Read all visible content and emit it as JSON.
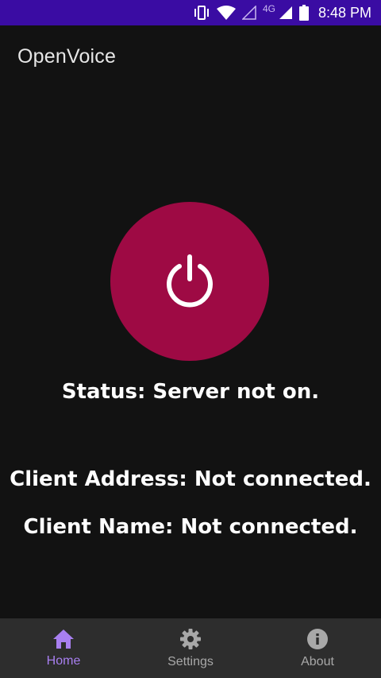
{
  "status_bar": {
    "network_type": "4G",
    "time": "8:48 PM",
    "icons": [
      "vibrate-icon",
      "wifi-icon",
      "signal-empty-icon",
      "signal-icon",
      "battery-icon"
    ]
  },
  "app_bar": {
    "title": "OpenVoice"
  },
  "main": {
    "power_button_icon": "power-icon",
    "power_button_color": "#9e0a44",
    "status_text": "Status: Server not on.",
    "client_address_text": "Client Address: Not connected.",
    "client_name_text": "Client Name: Not connected."
  },
  "bottom_nav": {
    "active_color": "#a87ff0",
    "items": [
      {
        "label": "Home",
        "icon": "home-icon",
        "active": true
      },
      {
        "label": "Settings",
        "icon": "gear-icon",
        "active": false
      },
      {
        "label": "About",
        "icon": "info-icon",
        "active": false
      }
    ]
  }
}
